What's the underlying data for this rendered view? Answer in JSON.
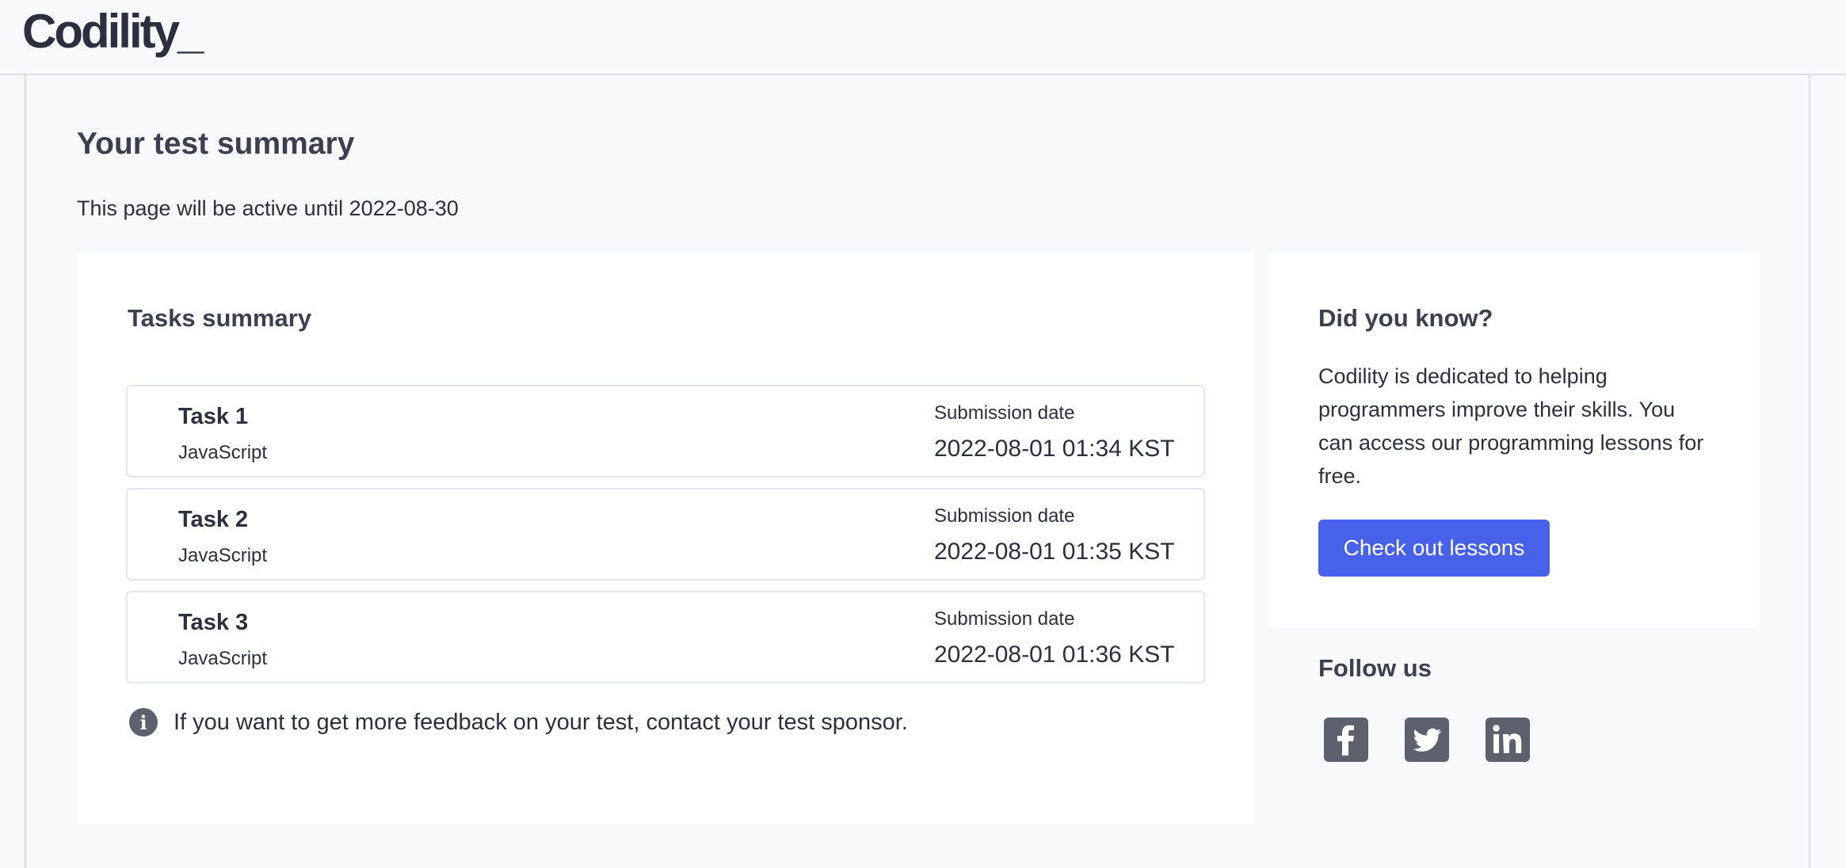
{
  "header": {
    "logo_text": "Codility_"
  },
  "page": {
    "title": "Your test summary",
    "active_note": "This page will be active until 2022-08-30"
  },
  "tasks_card": {
    "heading": "Tasks summary",
    "submission_label": "Submission date",
    "tasks": [
      {
        "name": "Task 1",
        "language": "JavaScript",
        "submission_date": "2022-08-01 01:34 KST"
      },
      {
        "name": "Task 2",
        "language": "JavaScript",
        "submission_date": "2022-08-01 01:35 KST"
      },
      {
        "name": "Task 3",
        "language": "JavaScript",
        "submission_date": "2022-08-01 01:36 KST"
      }
    ],
    "info_icon": "info-icon",
    "info_text": "If you want to get more feedback on your test, contact your test sponsor."
  },
  "did_you_know": {
    "heading": "Did you know?",
    "body": "Codility is dedicated to helping programmers improve their skills. You can access our programming lessons for free.",
    "button_label": "Check out lessons",
    "button_color": "#4761e8"
  },
  "follow": {
    "heading": "Follow us",
    "icons": [
      "facebook-icon",
      "twitter-icon",
      "linkedin-icon"
    ],
    "icon_color": "#5d616e"
  }
}
